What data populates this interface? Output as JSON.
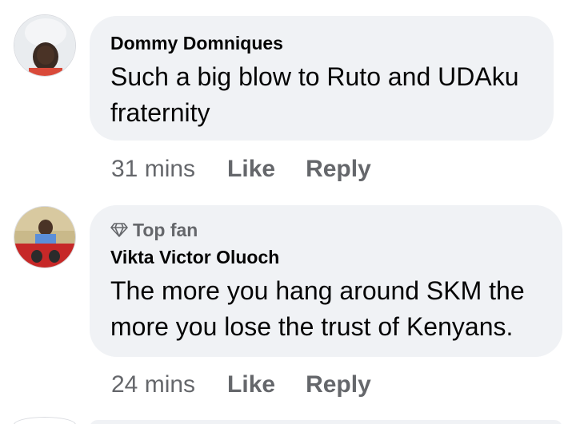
{
  "comments": [
    {
      "avatar_icon": "user-avatar-photo",
      "author": "Dommy Domniques",
      "text": "Such a big blow to Ruto and UDAku fraternity",
      "time": "31 mins",
      "like_label": "Like",
      "reply_label": "Reply"
    },
    {
      "avatar_icon": "user-avatar-photo",
      "badge_icon": "diamond-icon",
      "badge": "Top fan",
      "author": "Vikta Victor Oluoch",
      "text": "The more you hang around SKM the more you lose the trust of Kenyans.",
      "time": "24 mins",
      "like_label": "Like",
      "reply_label": "Reply"
    }
  ],
  "colors": {
    "bubble_bg": "#f0f2f5",
    "primary_text": "#050505",
    "secondary_text": "#65676b"
  }
}
